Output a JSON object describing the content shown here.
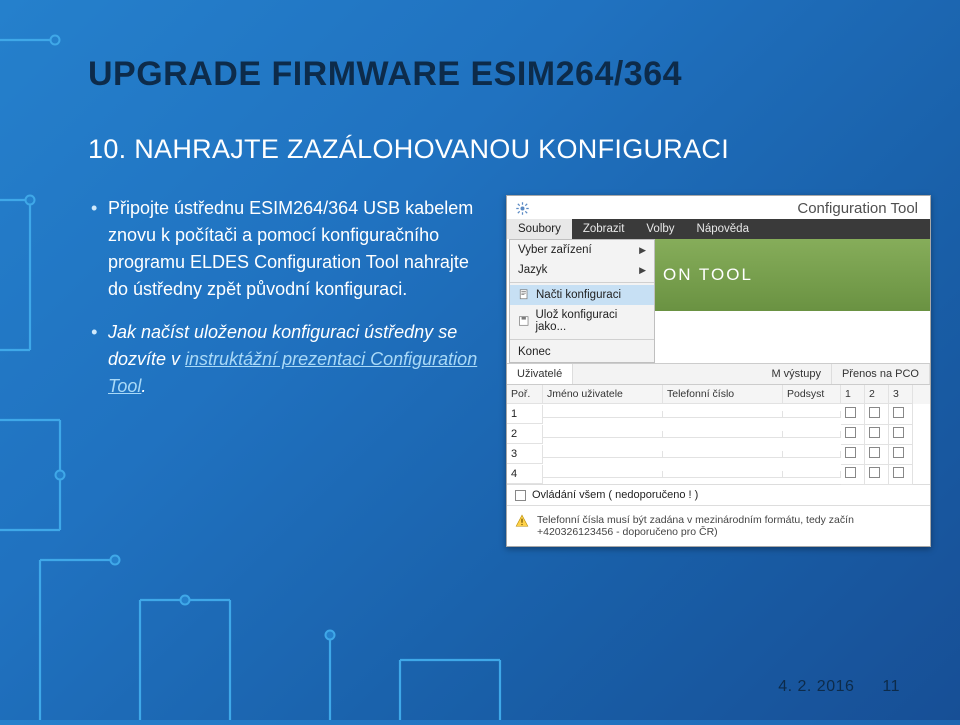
{
  "title": "UPGRADE FIRMWARE ESIM264/364",
  "step_title": "10. NAHRAJTE ZAZÁLOHOVANOU KONFIGURACI",
  "bullets": {
    "b1_pre": "Připojte ústřednu ESIM264/364 USB kabelem znovu k počítači a pomocí konfiguračního programu ELDES Configuration Tool nahrajte do ústředny zpět původní konfiguraci.",
    "b2_pre": "Jak načíst uloženou konfiguraci ústředny se dozvíte v ",
    "b2_link": "instruktážní prezentaci Configuration Tool",
    "b2_post": "."
  },
  "shot": {
    "app_title": "Configuration Tool",
    "menu": [
      "Soubory",
      "Zobrazit",
      "Volby",
      "Nápověda"
    ],
    "file_menu": {
      "select_device": "Vyber zařízení",
      "language": "Jazyk",
      "load_config": "Načti konfiguraci",
      "save_config": "Ulož konfiguraci jako...",
      "exit": "Konec"
    },
    "banner": "ON TOOL",
    "subtabs": [
      "Uživatelé",
      "M výstupy",
      "Přenos na PCO"
    ],
    "thead": [
      "Poř.",
      "Jméno uživatele",
      "Telefonní číslo",
      "Podsyst",
      "1",
      "2",
      "3"
    ],
    "rows": [
      "1",
      "2",
      "3",
      "4"
    ],
    "bottom_check": "Ovládání všem ( nedoporučeno ! )",
    "warn_line1": "Telefonní čísla musí být zadána v mezinárodním formátu, tedy začín",
    "warn_line2": "+420326123456 - doporučeno pro ČR)"
  },
  "footer": {
    "date": "4. 2. 2016",
    "page": "11"
  }
}
